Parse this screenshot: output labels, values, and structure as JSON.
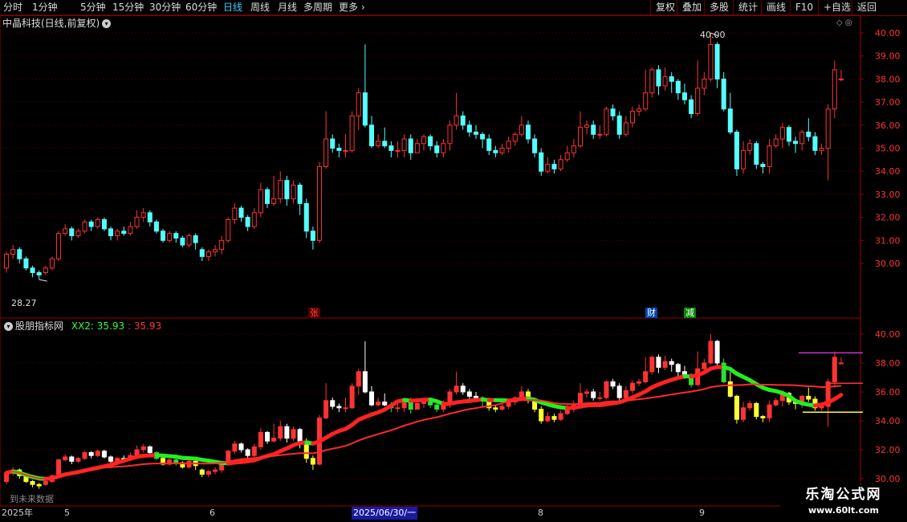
{
  "toolbar": {
    "periods": [
      "分时",
      "1分钟",
      "5分钟",
      "15分钟",
      "30分钟",
      "60分钟",
      "日线",
      "周线",
      "月线",
      "多周期",
      "更多"
    ],
    "active_period": "日线",
    "right_buttons": [
      "复权",
      "叠加",
      "多股",
      "统计",
      "画线",
      "F10",
      "+自选",
      "返回"
    ],
    "more_arrow": "›"
  },
  "main_panel": {
    "title": "中晶科技(日线,前复权)",
    "high_label": "40.00",
    "low_label": "28.27",
    "price_axis": [
      "40.00",
      "39.00",
      "38.00",
      "37.00",
      "36.00",
      "35.00",
      "34.00",
      "33.00",
      "32.00",
      "31.00",
      "30.00"
    ],
    "badges": [
      {
        "text": "张",
        "color": "#ff3333",
        "bg": "#550000"
      },
      {
        "text": "财",
        "color": "#ffffff",
        "bg": "#0044aa"
      },
      {
        "text": "减",
        "color": "#ffffff",
        "bg": "#008800"
      }
    ]
  },
  "indicator_panel": {
    "title": "股朋指标网",
    "series_label": "XX2:",
    "value1": "35.93",
    "value2": "35.93",
    "price_axis": [
      "40.00",
      "38.00",
      "36.00",
      "34.00",
      "32.00",
      "30.00"
    ],
    "no_data_text": "到未来数据"
  },
  "time_axis": {
    "labels": [
      "2025年",
      "5",
      "6",
      "2025/06/30/一",
      "8",
      "9"
    ],
    "highlight": "2025/06/30/一"
  },
  "watermark": {
    "line1": "乐淘公式网",
    "line2": "www.60lt.com"
  },
  "colors": {
    "up": "#ff3333",
    "down": "#54ffff",
    "grid": "#550000",
    "axis": "#990000"
  },
  "chart_data": {
    "type": "candlestick",
    "title": "中晶科技(日线,前复权)",
    "ylim": [
      29.0,
      40.5
    ],
    "candles": [
      [
        29.8,
        30.4,
        30.5,
        29.6
      ],
      [
        30.4,
        30.6,
        30.8,
        30.2
      ],
      [
        30.6,
        30.2,
        30.7,
        30.0
      ],
      [
        30.2,
        29.8,
        30.3,
        29.7
      ],
      [
        29.8,
        29.6,
        29.9,
        29.4
      ],
      [
        29.6,
        29.5,
        29.7,
        29.3
      ],
      [
        29.6,
        29.8,
        29.9,
        29.5
      ],
      [
        29.8,
        30.2,
        30.3,
        29.7
      ],
      [
        30.2,
        31.3,
        31.4,
        30.1
      ],
      [
        31.3,
        31.5,
        31.7,
        31.2
      ],
      [
        31.5,
        31.2,
        31.6,
        31.0
      ],
      [
        31.2,
        31.4,
        31.5,
        31.1
      ],
      [
        31.4,
        31.8,
        31.9,
        31.3
      ],
      [
        31.8,
        31.6,
        31.9,
        31.4
      ],
      [
        31.6,
        31.9,
        32.0,
        31.5
      ],
      [
        31.9,
        31.5,
        32.0,
        31.4
      ],
      [
        31.5,
        31.2,
        31.6,
        31.0
      ],
      [
        31.2,
        31.4,
        31.5,
        31.0
      ],
      [
        31.4,
        31.3,
        31.6,
        31.2
      ],
      [
        31.3,
        31.6,
        31.8,
        31.2
      ],
      [
        31.6,
        32.0,
        32.3,
        31.5
      ],
      [
        32.0,
        32.2,
        32.4,
        31.8
      ],
      [
        32.2,
        31.8,
        32.3,
        31.6
      ],
      [
        31.8,
        31.4,
        31.9,
        31.3
      ],
      [
        31.4,
        31.0,
        31.5,
        30.9
      ],
      [
        31.0,
        31.3,
        31.4,
        30.9
      ],
      [
        31.3,
        31.1,
        31.4,
        30.9
      ],
      [
        31.1,
        30.8,
        31.2,
        30.7
      ],
      [
        30.8,
        31.2,
        31.3,
        30.7
      ],
      [
        31.2,
        30.9,
        31.3,
        30.6
      ],
      [
        30.6,
        30.3,
        30.7,
        30.1
      ],
      [
        30.3,
        30.5,
        30.6,
        30.1
      ],
      [
        30.5,
        30.6,
        30.8,
        30.3
      ],
      [
        30.6,
        31.0,
        31.2,
        30.4
      ],
      [
        31.0,
        31.9,
        32.0,
        30.9
      ],
      [
        31.9,
        32.4,
        32.6,
        31.7
      ],
      [
        32.4,
        32.0,
        32.5,
        31.8
      ],
      [
        32.0,
        31.6,
        32.1,
        31.4
      ],
      [
        31.6,
        32.2,
        32.4,
        31.5
      ],
      [
        32.2,
        33.2,
        33.5,
        32.0
      ],
      [
        33.2,
        32.6,
        33.3,
        32.4
      ],
      [
        32.6,
        32.8,
        33.8,
        32.5
      ],
      [
        32.8,
        33.6,
        34.0,
        32.6
      ],
      [
        33.6,
        32.8,
        33.8,
        32.5
      ],
      [
        32.8,
        33.4,
        33.6,
        32.6
      ],
      [
        33.4,
        32.6,
        33.5,
        32.1
      ],
      [
        32.6,
        31.4,
        32.8,
        31.1
      ],
      [
        31.4,
        31.0,
        31.6,
        30.6
      ],
      [
        31.0,
        34.2,
        34.4,
        30.9
      ],
      [
        34.2,
        35.4,
        36.6,
        34.1
      ],
      [
        35.4,
        35.0,
        35.6,
        34.8
      ],
      [
        35.0,
        34.9,
        35.2,
        34.6
      ],
      [
        34.9,
        34.9,
        35.6,
        34.6
      ],
      [
        34.9,
        36.4,
        36.6,
        34.8
      ],
      [
        36.4,
        37.4,
        37.6,
        35.8
      ],
      [
        37.4,
        36.0,
        39.5,
        35.9
      ],
      [
        36.0,
        35.1,
        36.4,
        35.0
      ],
      [
        35.1,
        35.3,
        35.6,
        35.0
      ],
      [
        35.3,
        35.1,
        35.9,
        35.0
      ],
      [
        35.1,
        34.9,
        35.3,
        34.6
      ],
      [
        34.9,
        34.9,
        35.3,
        34.6
      ],
      [
        34.9,
        35.4,
        35.6,
        34.6
      ],
      [
        35.4,
        34.8,
        35.6,
        34.5
      ],
      [
        34.8,
        35.2,
        35.4,
        34.8
      ],
      [
        35.2,
        35.5,
        35.6,
        34.9
      ],
      [
        35.5,
        35.1,
        35.6,
        34.9
      ],
      [
        35.1,
        34.8,
        35.3,
        34.6
      ],
      [
        34.8,
        35.2,
        35.4,
        34.6
      ],
      [
        35.2,
        36.0,
        36.2,
        34.9
      ],
      [
        36.0,
        36.4,
        37.4,
        35.8
      ],
      [
        36.4,
        36.0,
        36.6,
        35.8
      ],
      [
        36.0,
        35.7,
        36.2,
        35.5
      ],
      [
        35.7,
        35.6,
        36.0,
        35.4
      ],
      [
        35.6,
        35.4,
        35.7,
        35.0
      ],
      [
        35.4,
        34.9,
        35.6,
        34.7
      ],
      [
        34.9,
        34.8,
        35.1,
        34.6
      ],
      [
        34.8,
        35.0,
        35.2,
        34.7
      ],
      [
        35.0,
        35.3,
        35.5,
        34.8
      ],
      [
        35.3,
        35.6,
        35.7,
        35.1
      ],
      [
        35.6,
        36.0,
        36.4,
        35.5
      ],
      [
        36.0,
        35.4,
        36.2,
        35.2
      ],
      [
        35.4,
        34.8,
        35.6,
        34.6
      ],
      [
        34.8,
        34.0,
        35.0,
        33.8
      ],
      [
        34.0,
        34.3,
        34.6,
        33.9
      ],
      [
        34.3,
        34.1,
        34.5,
        33.9
      ],
      [
        34.1,
        34.5,
        34.7,
        34.0
      ],
      [
        34.5,
        34.8,
        35.1,
        34.4
      ],
      [
        34.8,
        35.1,
        35.4,
        34.6
      ],
      [
        35.1,
        35.9,
        36.6,
        35.0
      ],
      [
        35.9,
        36.0,
        36.2,
        35.6
      ],
      [
        36.0,
        35.6,
        36.2,
        35.4
      ],
      [
        35.6,
        35.6,
        36.0,
        35.4
      ],
      [
        35.6,
        36.7,
        36.8,
        35.5
      ],
      [
        36.7,
        36.4,
        36.9,
        36.2
      ],
      [
        36.4,
        35.6,
        36.6,
        35.4
      ],
      [
        35.6,
        36.1,
        36.4,
        35.5
      ],
      [
        36.1,
        36.6,
        36.8,
        35.9
      ],
      [
        36.6,
        36.7,
        36.9,
        36.4
      ],
      [
        36.7,
        37.4,
        38.4,
        36.6
      ],
      [
        37.4,
        38.4,
        38.5,
        37.2
      ],
      [
        38.4,
        37.7,
        38.6,
        37.3
      ],
      [
        37.7,
        38.1,
        38.5,
        37.5
      ],
      [
        38.1,
        37.9,
        38.3,
        37.4
      ],
      [
        37.9,
        37.4,
        38.0,
        37.1
      ],
      [
        37.4,
        37.1,
        37.8,
        36.9
      ],
      [
        37.1,
        36.5,
        37.3,
        36.3
      ],
      [
        36.5,
        37.6,
        38.8,
        36.4
      ],
      [
        37.6,
        38.0,
        38.3,
        37.3
      ],
      [
        38.0,
        39.5,
        40.0,
        37.9
      ],
      [
        39.5,
        38.0,
        39.6,
        37.6
      ],
      [
        38.0,
        36.7,
        38.3,
        36.6
      ],
      [
        36.7,
        35.7,
        37.4,
        35.6
      ],
      [
        35.7,
        34.1,
        35.8,
        33.8
      ],
      [
        34.1,
        34.9,
        35.3,
        33.9
      ],
      [
        34.9,
        35.2,
        35.4,
        34.7
      ],
      [
        35.2,
        34.3,
        35.3,
        34.1
      ],
      [
        34.3,
        34.2,
        34.4,
        33.9
      ],
      [
        34.2,
        35.1,
        35.4,
        33.9
      ],
      [
        35.1,
        35.4,
        35.6,
        35.0
      ],
      [
        35.4,
        35.9,
        36.1,
        35.0
      ],
      [
        35.9,
        35.3,
        36.0,
        35.1
      ],
      [
        35.3,
        35.2,
        35.5,
        34.8
      ],
      [
        35.2,
        35.7,
        35.8,
        34.9
      ],
      [
        35.7,
        35.5,
        36.3,
        35.3
      ],
      [
        35.5,
        34.9,
        35.7,
        34.7
      ],
      [
        34.9,
        35.0,
        35.2,
        34.7
      ],
      [
        35.0,
        36.7,
        36.9,
        33.6
      ],
      [
        36.7,
        38.4,
        38.8,
        36.3
      ],
      [
        38.0,
        38.0,
        38.4,
        37.9
      ]
    ]
  }
}
